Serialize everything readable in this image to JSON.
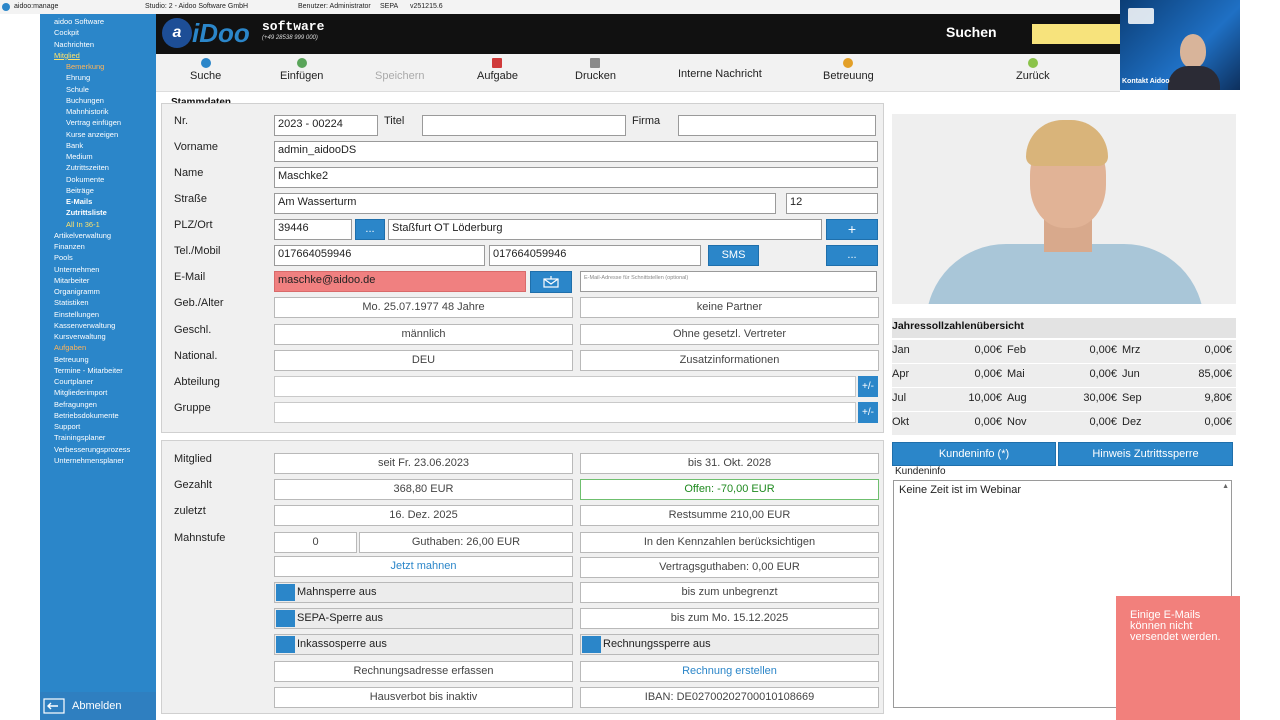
{
  "titlebar": {
    "app": "aidoo:manage",
    "studio": "Studio: 2 - Aidoo Software GmbH",
    "user": "Benutzer: Administrator",
    "sepa": "SEPA",
    "version": "v251215.6"
  },
  "sidebar": {
    "items": [
      "aidoo Software",
      "Cockpit",
      "Nachrichten",
      "Mitglied",
      "Bemerkung",
      "Ehrung",
      "Schule",
      "Buchungen",
      "Mahnhistorik",
      "Vertrag einfügen",
      "Kurse anzeigen",
      "Bank",
      "Medium",
      "Zutrittszeiten",
      "Dokumente",
      "Beiträge",
      "E-Mails",
      "Zutrittsliste",
      "All In 36-1",
      "Artikelverwaltung",
      "Finanzen",
      "Pools",
      "Unternehmen",
      "Mitarbeiter",
      "Organigramm",
      "Statistiken",
      "Einstellungen",
      "Kassenverwaltung",
      "Kursverwaltung",
      "Aufgaben",
      "Betreuung",
      "Termine - Mitarbeiter",
      "Courtplaner",
      "Mitgliederimport",
      "Befragungen",
      "Betriebsdokumente",
      "Support",
      "Trainingsplaner",
      "Verbesserungsprozess",
      "Unternehmensplaner"
    ],
    "logout": "Abmelden"
  },
  "header": {
    "logo": "iDoo",
    "brand": "software",
    "phone": "(+49 28538 999 000)",
    "search_label": "Suchen",
    "search_value": ""
  },
  "toolbar": {
    "suche": "Suche",
    "einfuegen": "Einfügen",
    "speichern": "Speichern",
    "aufgabe": "Aufgabe",
    "drucken": "Drucken",
    "nachricht": "Interne Nachricht",
    "betreuung": "Betreuung",
    "zurueck": "Zurück"
  },
  "video": {
    "label": "Kontakt Aidoo"
  },
  "stammdaten": {
    "title": "Stammdaten",
    "labels": {
      "nr": "Nr.",
      "titel": "Titel",
      "firma": "Firma",
      "vorname": "Vorname",
      "name": "Name",
      "strasse": "Straße",
      "plz": "PLZ/Ort",
      "tel": "Tel./Mobil",
      "email": "E-Mail",
      "geb": "Geb./Alter",
      "geschl": "Geschl.",
      "national": "National.",
      "abteilung": "Abteilung",
      "gruppe": "Gruppe"
    },
    "nr": "2023 - 00224",
    "titel": "",
    "firma": "",
    "vorname": "admin_aidooDS",
    "name": "Maschke2",
    "strasse": "Am Wasserturm",
    "hausnr": "12",
    "plz": "39446",
    "ort": "Staßfurt OT Löderburg",
    "tel": "017664059946",
    "mobil": "017664059946",
    "sms": "SMS",
    "email": "maschke@aidoo.de",
    "email_alt_placeholder": "E-Mail-Adresse für Schnittstellen (optional)",
    "geb": "Mo. 25.07.1977  48 Jahre",
    "partner": "keine Partner",
    "geschlecht": "männlich",
    "vertreter": "Ohne gesetzl. Vertreter",
    "nationalitaet": "DEU",
    "zusatz": "Zusatzinformationen",
    "abteilung": "",
    "gruppe": "",
    "plusminus": "+/-",
    "dots": "...",
    "plus": "+"
  },
  "mitgliedschaft": {
    "labels": {
      "mitglied": "Mitglied",
      "gezahlt": "Gezahlt",
      "zuletzt": "zuletzt",
      "mahnstufe": "Mahnstufe"
    },
    "seit": "seit Fr. 23.06.2023",
    "bis": "bis 31. Okt. 2028",
    "gezahlt": "368,80 EUR",
    "offen": "Offen: -70,00 EUR",
    "zuletzt": "16. Dez. 2025",
    "restsumme": "Restsumme 210,00 EUR",
    "mahnstufe": "0",
    "guthaben": "Guthaben: 26,00 EUR",
    "kennzahlen": "In den Kennzahlen berücksichtigen",
    "jetzt_mahnen": "Jetzt mahnen",
    "vertragsguthaben": "Vertragsguthaben: 0,00 EUR",
    "mahnsperre": "Mahnsperre aus",
    "unbegrenzt": "bis zum unbegrenzt",
    "sepasperre": "SEPA-Sperre aus",
    "bis_mo": "bis zum Mo. 15.12.2025",
    "inkasso": "Inkassosperre aus",
    "rechnungssperre": "Rechnungssperre aus",
    "rechnungsadresse": "Rechnungsadresse erfassen",
    "rechnung_erstellen": "Rechnung erstellen",
    "hausverbot": "Hausverbot bis inaktiv",
    "iban": "IBAN: DE02700202700010108669"
  },
  "jahres": {
    "title": "Jahressollzahlenübersicht",
    "months": [
      {
        "m": "Jan",
        "v": "0,00€"
      },
      {
        "m": "Feb",
        "v": "0,00€"
      },
      {
        "m": "Mrz",
        "v": "0,00€"
      },
      {
        "m": "Apr",
        "v": "0,00€"
      },
      {
        "m": "Mai",
        "v": "0,00€"
      },
      {
        "m": "Jun",
        "v": "85,00€"
      },
      {
        "m": "Jul",
        "v": "10,00€"
      },
      {
        "m": "Aug",
        "v": "30,00€"
      },
      {
        "m": "Sep",
        "v": "9,80€"
      },
      {
        "m": "Okt",
        "v": "0,00€"
      },
      {
        "m": "Nov",
        "v": "0,00€"
      },
      {
        "m": "Dez",
        "v": "0,00€"
      }
    ]
  },
  "kunden": {
    "info_btn": "Kundeninfo (*)",
    "hinweis_btn": "Hinweis Zutrittssperre",
    "label": "Kundeninfo",
    "text": "Keine Zeit ist im Webinar"
  },
  "toast": {
    "text": "Einige E-Mails können nicht versendet werden."
  },
  "colors": {
    "accent": "#2b86c9",
    "header": "#111111",
    "toast": "#f2807c",
    "email_bg": "#f08080",
    "search": "#f7e37c"
  }
}
